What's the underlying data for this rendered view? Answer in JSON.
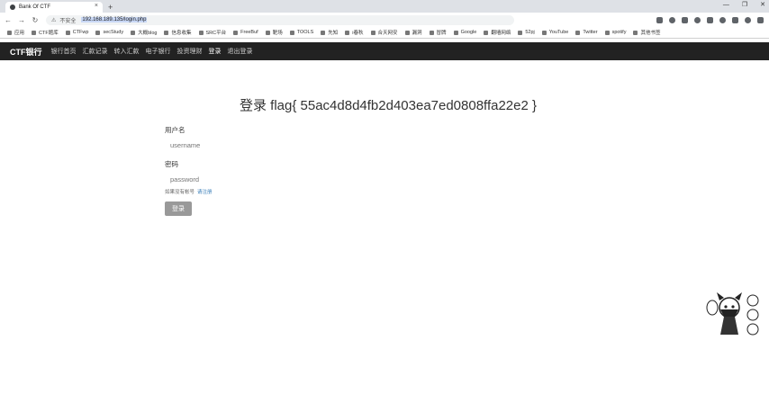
{
  "browser": {
    "tab_title": "Bank Of CTF",
    "tab_close": "×",
    "new_tab": "+",
    "window_controls": [
      "—",
      "❐",
      "✕"
    ],
    "security_label": "不安全",
    "url": "192.168.189.135/login.php",
    "nav_icons": [
      "back-arrow-icon",
      "forward-arrow-icon",
      "reload-icon"
    ]
  },
  "bookmarks": [
    "应用",
    "CTF题库",
    "CTFwp",
    "secStudy",
    "大概blog",
    "信息收集",
    "SRC平台",
    "FreeBuf",
    "靶场",
    "TOOLS",
    "先知",
    "i春秋",
    "合天网安",
    "漏洞",
    "冒牌",
    "Google",
    "翻墙网络",
    "52pj",
    "YouTube",
    "Twitter",
    "spotify",
    "其他书签"
  ],
  "site": {
    "brand": "CTF银行",
    "nav": [
      "银行首页",
      "汇款记录",
      "转入汇款",
      "电子银行",
      "投资理财",
      "登录",
      "退出登录"
    ],
    "active_nav_index": 5
  },
  "login": {
    "title": "登录 flag{ 55ac4d8d4fb2d403ea7ed0808ffa22e2 }",
    "username_label": "用户名",
    "username_placeholder": "username",
    "password_label": "密码",
    "password_placeholder": "password",
    "hint_text": "如果没有帐号",
    "register_link": "请注册",
    "submit_label": "登录"
  },
  "colors": {
    "navbar_bg": "#222222",
    "button_bg": "#999999",
    "link": "#337ab7"
  }
}
